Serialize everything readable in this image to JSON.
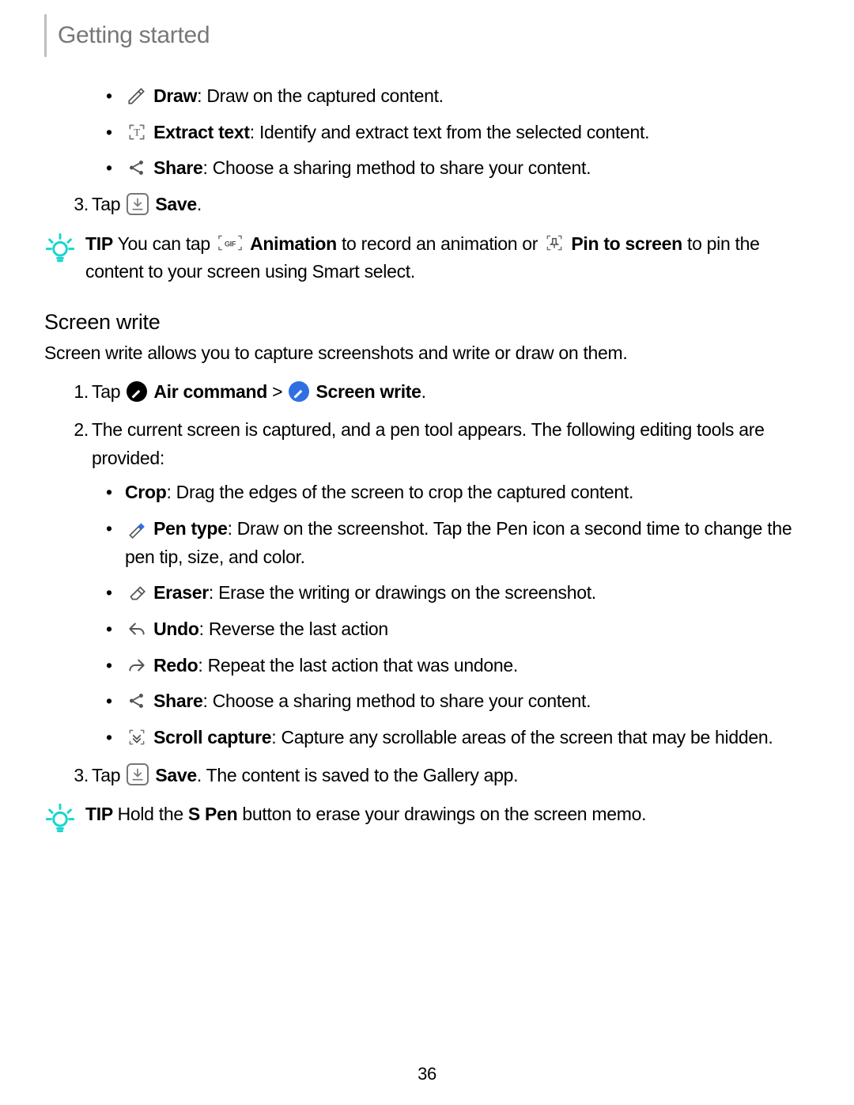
{
  "header": {
    "title": "Getting started"
  },
  "top_bullets": [
    {
      "label": "Draw",
      "desc": ": Draw on the captured content.",
      "icon": "pencil-icon"
    },
    {
      "label": "Extract text",
      "desc": ": Identify and extract text from the selected content.",
      "icon": "extract-text-icon"
    },
    {
      "label": "Share",
      "desc": ": Choose a sharing method to share your content.",
      "icon": "share-icon"
    }
  ],
  "step3_top": {
    "num": "3.",
    "tap": "Tap ",
    "save": "Save",
    "tail": "."
  },
  "tip1": {
    "tip_label": "TIP  ",
    "t1": "You can tap ",
    "anim": "Animation",
    "t2": " to record an animation or ",
    "pin": "Pin to screen",
    "t3": " to pin the content to your screen using Smart select."
  },
  "section": {
    "heading": "Screen write",
    "para": "Screen write allows you to capture screenshots and write or draw on them."
  },
  "screenwrite_steps": {
    "s1": {
      "num": "1.",
      "tap": "Tap ",
      "air": "Air command",
      "gt": " > ",
      "sw": "Screen write",
      "tail": "."
    },
    "s2": {
      "num": "2.",
      "text": "The current screen is captured, and a pen tool appears. The following editing tools are provided:",
      "bullets": [
        {
          "label": "Crop",
          "desc": ": Drag the edges of the screen to crop the captured content.",
          "icon": null
        },
        {
          "label": "Pen type",
          "desc": ": Draw on the screenshot. Tap the Pen icon a second time to change the pen tip, size, and color.",
          "icon": "pen-type-icon"
        },
        {
          "label": "Eraser",
          "desc": ": Erase the writing or drawings on the screenshot.",
          "icon": "eraser-icon"
        },
        {
          "label": "Undo",
          "desc": ": Reverse the last action",
          "icon": "undo-icon"
        },
        {
          "label": "Redo",
          "desc": ": Repeat the last action that was undone.",
          "icon": "redo-icon"
        },
        {
          "label": "Share",
          "desc": ": Choose a sharing method to share your content.",
          "icon": "share-icon"
        },
        {
          "label": "Scroll capture",
          "desc": ": Capture any scrollable areas of the screen that may be hidden.",
          "icon": "scroll-capture-icon"
        }
      ]
    },
    "s3": {
      "num": "3.",
      "tap": "Tap ",
      "save": "Save",
      "tail": ". The content is saved to the Gallery app."
    }
  },
  "tip2": {
    "tip_label": "TIP  ",
    "t1": "Hold the ",
    "spen": "S Pen",
    "t2": " button to erase your drawings on the screen memo."
  },
  "page_number": "36"
}
